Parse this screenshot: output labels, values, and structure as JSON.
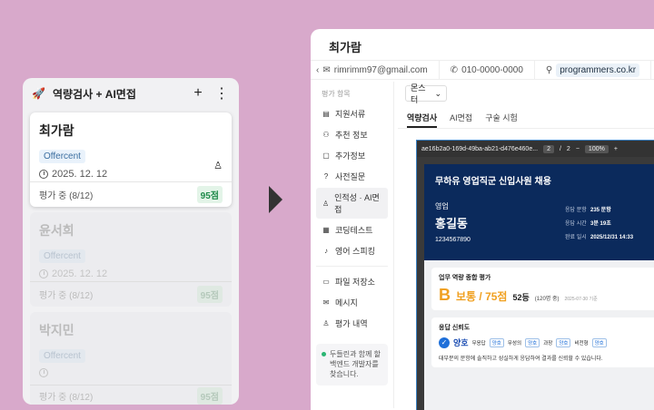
{
  "kanban": {
    "title": "역량검사 + AI면접",
    "cards": [
      {
        "name": "최가람",
        "company": "Offercent",
        "date": "2025. 12. 12",
        "status": "평가 중 (8/12)",
        "score": "95점"
      },
      {
        "name": "윤서희",
        "company": "Offercent",
        "date": "2025. 12. 12",
        "status": "평가 중 (8/12)",
        "score": "95점"
      },
      {
        "name": "박지민",
        "company": "Offercent",
        "date": "",
        "status": "평가 중 (8/12)",
        "score": "95점"
      }
    ]
  },
  "window": {
    "title": "최가람",
    "email": "rimrimm97@gmail.com",
    "phone": "010-0000-0000",
    "site": "programmers.co.kr"
  },
  "sidebar": {
    "section": "평가 항목",
    "items": [
      {
        "label": "지원서류",
        "icon": "doc-icon",
        "glyph": "▤"
      },
      {
        "label": "추천 정보",
        "icon": "people-icon",
        "glyph": "⚇"
      },
      {
        "label": "추가정보",
        "icon": "clipboard-icon",
        "glyph": "▢"
      },
      {
        "label": "사전질문",
        "icon": "question-icon",
        "glyph": "?"
      },
      {
        "label": "인적성 · AI면접",
        "icon": "ai-icon",
        "glyph": "♙"
      },
      {
        "label": "코딩테스트",
        "icon": "code-icon",
        "glyph": "▦"
      },
      {
        "label": "영어 스피킹",
        "icon": "speech-icon",
        "glyph": "♪"
      }
    ],
    "items2": [
      {
        "label": "파일 저장소",
        "icon": "folder-icon",
        "glyph": "▭"
      },
      {
        "label": "메시지",
        "icon": "message-icon",
        "glyph": "✉"
      },
      {
        "label": "평가 내역",
        "icon": "history-icon",
        "glyph": "♙"
      }
    ],
    "note": "두들린과 함께 할 백엔드 개발자를 찾습니다."
  },
  "main": {
    "dropdown": "몬스터",
    "tabs": [
      "역량검사",
      "AI면접",
      "구술 시험"
    ],
    "viewer": {
      "filename": "ae16b2a0-169d-49ba-ab21-d476e460e...",
      "page": "2",
      "pages": "2",
      "zoom": "100%"
    },
    "doc": {
      "title": "무하유 영업직군 신입사원 채용",
      "dept": "영업",
      "candidate": "홍길동",
      "phone": "1234567890",
      "meta": [
        {
          "k": "응답 문항",
          "v": "235 문항"
        },
        {
          "k": "응답 시간",
          "v": "3분 19초"
        },
        {
          "k": "완료 일시",
          "v": "2025/12/31 14:33"
        }
      ],
      "eval_title": "업무 역량 종합 평가",
      "grade": "B",
      "grade_text": "보통 / 75점",
      "rank": "52등",
      "rank_sub": "(120명 중)",
      "base_date": "2025-07-30 기준",
      "reliability_title": "응답 신뢰도",
      "reliability": "양호",
      "checks": [
        {
          "k": "무응답",
          "v": "양호"
        },
        {
          "k": "무성의",
          "v": "양호"
        },
        {
          "k": "과장",
          "v": "양호"
        },
        {
          "k": "비전형",
          "v": "양호"
        }
      ],
      "reliability_desc": "대부분의 문항에 솔직하고 성실하게 응답하여 결과를 신뢰할 수 있습니다."
    }
  }
}
